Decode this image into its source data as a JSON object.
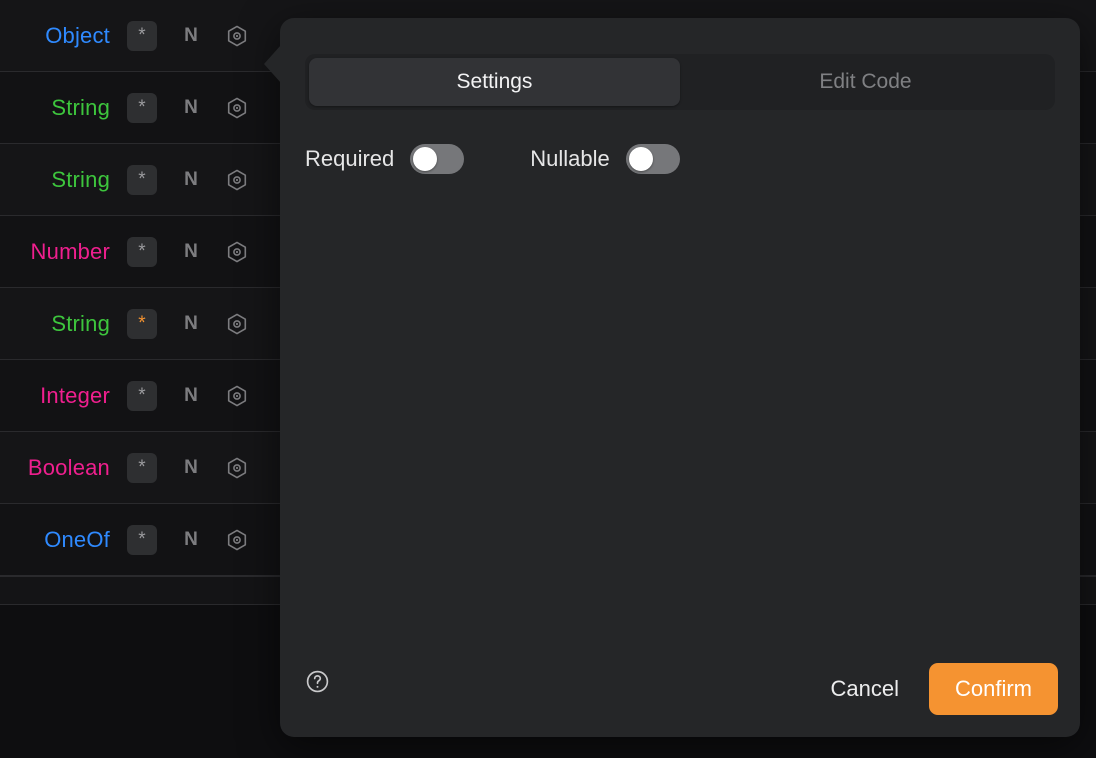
{
  "schema_list": {
    "rows": [
      {
        "type": "Object",
        "type_class": "type-object",
        "star": "*",
        "star_active": false,
        "nullable_flag": "N",
        "settings_icon": "hex-nut-icon"
      },
      {
        "type": "String",
        "type_class": "type-string",
        "star": "*",
        "star_active": false,
        "nullable_flag": "N",
        "settings_icon": "hex-nut-icon"
      },
      {
        "type": "String",
        "type_class": "type-string",
        "star": "*",
        "star_active": false,
        "nullable_flag": "N",
        "settings_icon": "hex-nut-icon"
      },
      {
        "type": "Number",
        "type_class": "type-number",
        "star": "*",
        "star_active": false,
        "nullable_flag": "N",
        "settings_icon": "hex-nut-icon"
      },
      {
        "type": "String",
        "type_class": "type-string",
        "star": "*",
        "star_active": true,
        "nullable_flag": "N",
        "settings_icon": "hex-nut-icon"
      },
      {
        "type": "Integer",
        "type_class": "type-integer",
        "star": "*",
        "star_active": false,
        "nullable_flag": "N",
        "settings_icon": "hex-nut-icon"
      },
      {
        "type": "Boolean",
        "type_class": "type-boolean",
        "star": "*",
        "star_active": false,
        "nullable_flag": "N",
        "settings_icon": "hex-nut-icon"
      },
      {
        "type": "OneOf",
        "type_class": "type-oneof",
        "star": "*",
        "star_active": false,
        "nullable_flag": "N",
        "settings_icon": "hex-nut-icon"
      }
    ]
  },
  "dialog": {
    "tabs": [
      {
        "label": "Settings",
        "selected": true
      },
      {
        "label": "Edit Code",
        "selected": false
      }
    ],
    "toggles": [
      {
        "label": "Required",
        "on": false
      },
      {
        "label": "Nullable",
        "on": false
      }
    ],
    "footer": {
      "help_icon": "question-circle-icon",
      "cancel_label": "Cancel",
      "confirm_label": "Confirm"
    }
  },
  "colors": {
    "accent": "#f59331",
    "type_blue": "#2f8aff",
    "type_green": "#3dc53d",
    "type_pink": "#ef1f8e",
    "dialog_bg": "#252628",
    "page_bg": "#0e0e10"
  }
}
